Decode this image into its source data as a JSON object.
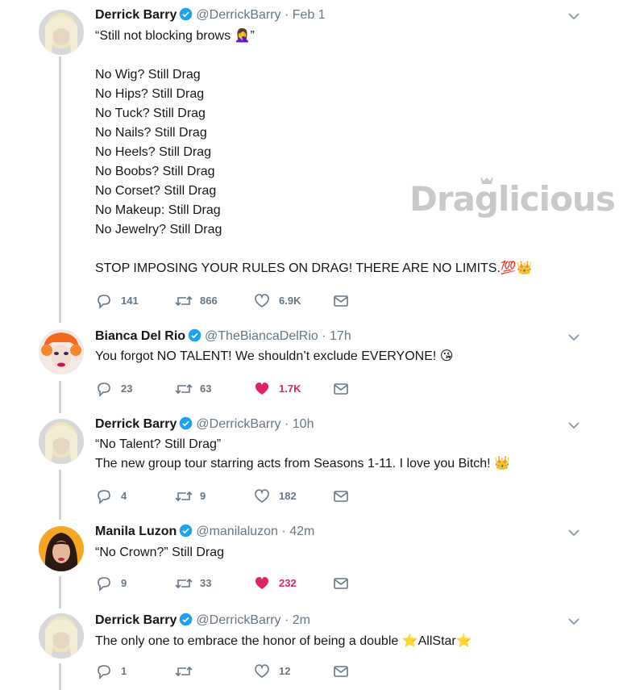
{
  "tweets": [
    {
      "name": "Derrick Barry",
      "handle": "@DerrickBarry",
      "time": "Feb 1",
      "text": "“Still not blocking brows 🤦‍♀️”\n\nNo Wig? Still Drag\nNo Hips? Still Drag\nNo Tuck? Still Drag\nNo Nails? Still Drag\nNo Heels? Still Drag\nNo Boobs? Still Drag\nNo Corset? Still Drag\nNo Makeup: Still Drag\nNo Jewelry? Still Drag\n\nSTOP IMPOSING YOUR RULES ON DRAG! THERE ARE NO LIMITS.💯👑",
      "replies": "141",
      "retweets": "866",
      "likes": "6.9K",
      "liked": false
    },
    {
      "name": "Bianca Del Rio",
      "handle": "@TheBiancaDelRio",
      "time": "17h",
      "text": "You forgot NO TALENT! We shouldn’t exclude EVERYONE! 😘",
      "replies": "23",
      "retweets": "63",
      "likes": "1.7K",
      "liked": true
    },
    {
      "name": "Derrick Barry",
      "handle": "@DerrickBarry",
      "time": "10h",
      "text": "“No Talent? Still Drag”\nThe new group tour starring acts from Seasons 1-11. I love you Bitch! 👑",
      "replies": "4",
      "retweets": "9",
      "likes": "182",
      "liked": false
    },
    {
      "name": "Manila Luzon",
      "handle": "@manilaluzon",
      "time": "42m",
      "text": "“No Crown?” Still Drag",
      "replies": "9",
      "retweets": "33",
      "likes": "232",
      "liked": true
    },
    {
      "name": "Derrick Barry",
      "handle": "@DerrickBarry",
      "time": "2m",
      "text": "The only one to embrace the honor of being a double ⭐AllStar⭐",
      "replies": "1",
      "retweets": "",
      "likes": "12",
      "liked": false
    }
  ],
  "separator": "·",
  "watermark": "Draglicious",
  "colors": {
    "text": "#14171a",
    "secondary": "#657786",
    "verified": "#1da1f2",
    "like_active": "#e0245e",
    "thread_line": "#ccd6dd",
    "watermark": "#c9c9c9"
  },
  "icons": [
    "reply-icon",
    "retweet-icon",
    "heart-icon",
    "message-icon",
    "verified-badge-icon",
    "chevron-down-icon",
    "crown-icon"
  ]
}
